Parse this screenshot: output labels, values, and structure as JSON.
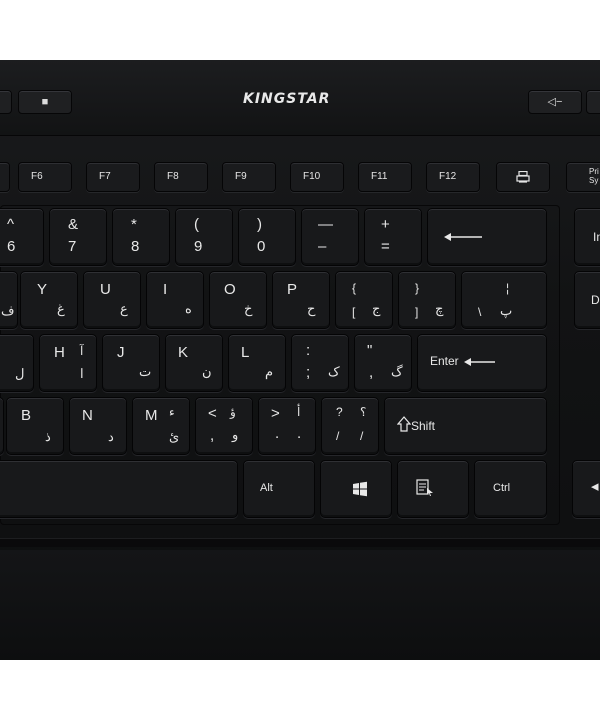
{
  "brand": "KINGSTAR",
  "media": {
    "stop": "■",
    "vol_down": "◁−"
  },
  "function_keys": [
    "F6",
    "F7",
    "F8",
    "F9",
    "F10",
    "F11",
    "F12"
  ],
  "print_screen": {
    "icon": "printer-icon",
    "label_partial": "Pri\nSy"
  },
  "row_numbers": {
    "k_caret": {
      "top": "^",
      "bottom": "6"
    },
    "k_amp": {
      "top": "&",
      "bottom": "7"
    },
    "k_star": {
      "top": "*",
      "bottom": "8"
    },
    "k_lparen": {
      "top": "(",
      "bottom": "9"
    },
    "k_rparen": {
      "top": ")",
      "bottom": "0"
    },
    "k_minus": {
      "top": "—",
      "bottom": "–"
    },
    "k_plus": {
      "top": "+",
      "bottom": "="
    },
    "backspace_icon": "arrow-left-icon",
    "insert_partial": "In"
  },
  "row_qwerty": {
    "y": {
      "latin": "Y",
      "persian": "غ"
    },
    "u": {
      "latin": "U",
      "persian": "ع"
    },
    "i": {
      "latin": "I",
      "persian": "ه"
    },
    "o": {
      "latin": "O",
      "persian": "خ"
    },
    "p": {
      "latin": "P",
      "persian": "ح"
    },
    "lbrace": {
      "top": "{",
      "bl": "[",
      "br": "ج"
    },
    "rbrace": {
      "top": "}",
      "bl": "]",
      "br": "چ"
    },
    "pipe": {
      "top": "¦",
      "bl": "\\",
      "br": "پ"
    },
    "left_partial": "ف",
    "delete_partial": "D"
  },
  "row_home": {
    "h": {
      "latin": "H",
      "tr": "آ",
      "br": "ا"
    },
    "j": {
      "latin": "J",
      "br": "ت"
    },
    "k": {
      "latin": "K",
      "br": "ن"
    },
    "l": {
      "latin": "L",
      "br": "م"
    },
    "colon": {
      "top": ":",
      "bl": ";",
      "br": "ک"
    },
    "quote": {
      "top": "\"",
      "bl": ",",
      "br": "گ"
    },
    "left_partial": "ل",
    "enter": "Enter"
  },
  "row_bottom": {
    "b": {
      "latin": "B",
      "br": "ذ"
    },
    "n": {
      "latin": "N",
      "br": "د"
    },
    "m": {
      "latin": "M",
      "tr": "ء",
      "br": "ئ"
    },
    "lt": {
      "top": "<",
      "tr": "ؤ",
      "bl": ",",
      "br": "و"
    },
    "gt": {
      "top": ">",
      "tr": "أ",
      "bl": ".",
      "br": "."
    },
    "slash": {
      "top": "?",
      "tr": "؟",
      "bl": "/",
      "br": "/"
    },
    "shift": "Shift"
  },
  "row_space": {
    "alt": "Alt",
    "win_icon": "windows-logo-icon",
    "menu_icon": "context-menu-icon",
    "ctrl": "Ctrl",
    "arrow_partial": "◂"
  }
}
